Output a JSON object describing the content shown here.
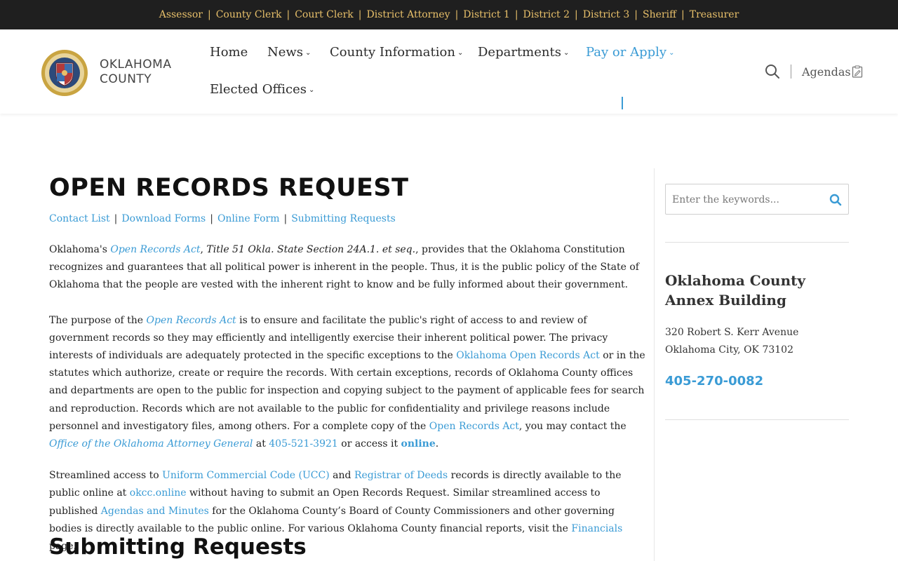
{
  "topbar": {
    "links": [
      "Assessor",
      "County Clerk",
      "Court Clerk",
      "District Attorney",
      "District 1",
      "District 2",
      "District 3",
      "Sheriff",
      "Treasurer"
    ]
  },
  "logo": {
    "line1": "OKLAHOMA",
    "line2": "COUNTY"
  },
  "nav": {
    "home": "Home",
    "news": "News",
    "county_information": "County Information",
    "departments": "Departments",
    "pay_or_apply": "Pay or Apply",
    "elected_offices": "Elected Offices",
    "agendas": "Agendas"
  },
  "colors": {
    "accent": "#3a9bd5",
    "topbar_bg": "#1f1f1f",
    "topbar_link": "#e8c06a"
  },
  "page": {
    "title": "OPEN RECORDS REQUEST",
    "subnav": [
      "Contact List",
      "Download Forms",
      "Online Form",
      "Submitting Requests"
    ],
    "p1": {
      "a": "Oklahoma's ",
      "link1": "Open Records Act",
      "b": ", ",
      "it1": "Title 51 Okla. State Section 24A.1. et seq.",
      "c": ", provides that the Oklahoma Constitution recognizes and guarantees that all political power is inherent in the people. Thus, it is the public policy of the State of Oklahoma that the people are vested with the inherent right to know and be fully informed about their government."
    },
    "p2": {
      "a": "The purpose of the ",
      "link1": "Open Records Act",
      "b": " is to ensure and facilitate the public's right of access to and review of government records so they may efficiently and intelligently exercise their inherent political power. The privacy interests of individuals are adequately protected in the specific exceptions to the ",
      "link2": "Oklahoma Open Records Act",
      "c": " or in the statutes which authorize, create or require the records. With certain exceptions, records of Oklahoma County offices and departments are open to the public for inspection and copying subject to the payment of applicable fees for search and reproduction. Records which are not available to the public for confidentiality and privilege reasons include personnel and investigatory files, among others. For a complete copy of the ",
      "link3": "Open Records Act",
      "d": ", you may contact the ",
      "link4": "Office of the Oklahoma Attorney General",
      "e": " at ",
      "link5": "405-521-3921",
      "f": " or access it ",
      "link6": "online",
      "g": "."
    },
    "p3": {
      "a": "Streamlined access to ",
      "link1": "Uniform Commercial Code (UCC)",
      "b": " and ",
      "link2": "Registrar of Deeds",
      "c": " records is directly available to the public online at ",
      "link3": "okcc.online",
      "d": " without having to submit an Open Records Request.  Similar streamlined access to published ",
      "link4": "Agendas and Minutes",
      "e": " for the Oklahoma County’s Board of County Commissioners and other governing bodies is directly available to the public online. For various Oklahoma County financial reports, visit the ",
      "link5": "Financials",
      "f": " page."
    },
    "h2": "Submitting Requests"
  },
  "sidebar": {
    "search_placeholder": "Enter the keywords...",
    "building_title": "Oklahoma County Annex Building",
    "address_line1": "320 Robert S. Kerr Avenue",
    "address_line2": "Oklahoma City, OK 73102",
    "phone": "405-270-0082"
  }
}
